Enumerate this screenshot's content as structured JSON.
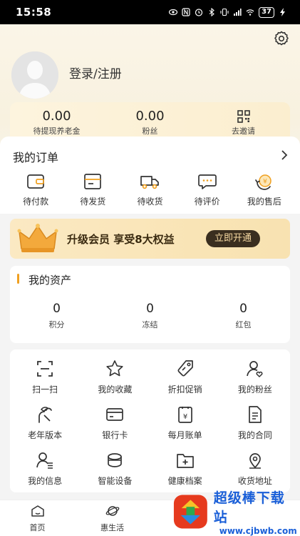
{
  "status_bar": {
    "time": "15:58",
    "battery": "37"
  },
  "profile": {
    "login_label": "登录/注册"
  },
  "stats": [
    {
      "value": "0.00",
      "label": "待提现养老金"
    },
    {
      "value": "0.00",
      "label": "粉丝"
    },
    {
      "label": "去邀请",
      "icon": "qr-code-icon"
    }
  ],
  "orders": {
    "title": "我的订单",
    "items": [
      {
        "label": "待付款",
        "icon": "wallet-icon"
      },
      {
        "label": "待发货",
        "icon": "box-icon"
      },
      {
        "label": "待收货",
        "icon": "truck-icon"
      },
      {
        "label": "待评价",
        "icon": "comment-icon"
      },
      {
        "label": "我的售后",
        "icon": "refund-icon"
      }
    ]
  },
  "member": {
    "text": "升级会员 享受8大权益",
    "button": "立即开通"
  },
  "assets": {
    "title": "我的资产",
    "items": [
      {
        "value": "0",
        "label": "积分"
      },
      {
        "value": "0",
        "label": "冻结"
      },
      {
        "value": "0",
        "label": "红包"
      }
    ]
  },
  "services": [
    {
      "label": "扫一扫",
      "icon": "scan-icon"
    },
    {
      "label": "我的收藏",
      "icon": "star-icon"
    },
    {
      "label": "折扣促销",
      "icon": "tag-icon"
    },
    {
      "label": "我的粉丝",
      "icon": "fan-icon"
    },
    {
      "label": "老年版本",
      "icon": "elder-icon"
    },
    {
      "label": "银行卡",
      "icon": "bank-card-icon"
    },
    {
      "label": "每月账单",
      "icon": "bill-icon"
    },
    {
      "label": "我的合同",
      "icon": "contract-icon"
    },
    {
      "label": "我的信息",
      "icon": "user-info-icon"
    },
    {
      "label": "智能设备",
      "icon": "device-icon"
    },
    {
      "label": "健康档案",
      "icon": "health-folder-icon"
    },
    {
      "label": "收货地址",
      "icon": "location-icon"
    }
  ],
  "nav": [
    {
      "label": "首页",
      "icon": "home-icon"
    },
    {
      "label": "惠生活",
      "icon": "planet-icon"
    }
  ],
  "watermark": {
    "title": "超级棒下载站",
    "url": "www.cjbwb.com"
  },
  "colors": {
    "accent": "#f0a020",
    "member_button_bg": "#3a2e1f",
    "member_button_text": "#f6d9a2",
    "watermark_blue": "#1a5fd8"
  }
}
